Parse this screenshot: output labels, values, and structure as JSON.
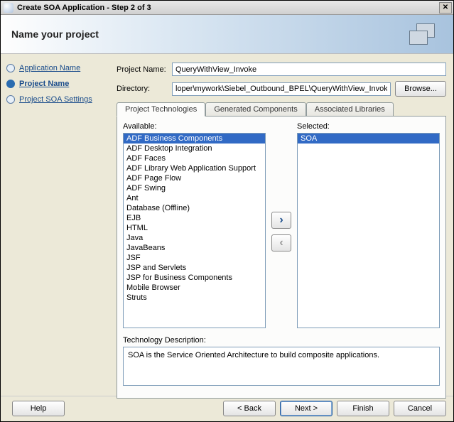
{
  "window": {
    "title": "Create SOA Application - Step 2 of 3",
    "close_icon": "✕"
  },
  "banner": {
    "heading": "Name your project"
  },
  "nav": {
    "items": [
      {
        "label": "Application Name",
        "active": false
      },
      {
        "label": "Project Name",
        "active": true
      },
      {
        "label": "Project SOA Settings",
        "active": false
      }
    ]
  },
  "form": {
    "project_name_label": "Project Name:",
    "project_name_value": "QueryWithView_Invoke",
    "directory_label": "Directory:",
    "directory_value": "loper\\mywork\\Siebel_Outbound_BPEL\\QueryWithView_Invoke",
    "browse_label": "Browse..."
  },
  "tabs": {
    "items": [
      {
        "label": "Project Technologies",
        "active": true
      },
      {
        "label": "Generated Components",
        "active": false
      },
      {
        "label": "Associated Libraries",
        "active": false
      }
    ]
  },
  "shuttle": {
    "available_label": "Available:",
    "selected_label": "Selected:",
    "available": [
      "ADF Business Components",
      "ADF Desktop Integration",
      "ADF Faces",
      "ADF Library Web Application Support",
      "ADF Page Flow",
      "ADF Swing",
      "Ant",
      "Database (Offline)",
      "EJB",
      "HTML",
      "Java",
      "JavaBeans",
      "JSF",
      "JSP and Servlets",
      "JSP for Business Components",
      "Mobile Browser",
      "Struts"
    ],
    "available_selected_index": 0,
    "selected": [
      "SOA"
    ],
    "selected_selected_index": 0
  },
  "description": {
    "label": "Technology Description:",
    "text": "SOA is the Service Oriented Architecture to build composite applications."
  },
  "footer": {
    "help": "Help",
    "back": "< Back",
    "next": "Next >",
    "finish": "Finish",
    "cancel": "Cancel"
  }
}
